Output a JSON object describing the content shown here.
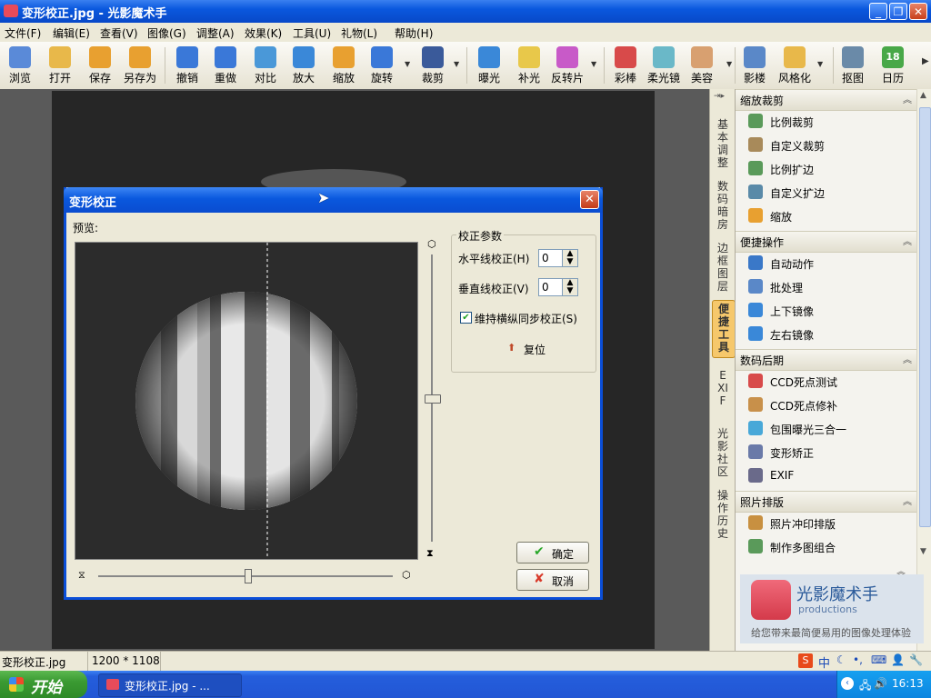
{
  "window": {
    "title": "变形校正.jpg - 光影魔术手",
    "buttons": [
      "_",
      "❐",
      "✕"
    ]
  },
  "menu": [
    "文件(F)",
    "编辑(E)",
    "查看(V)",
    "图像(G)",
    "调整(A)",
    "效果(K)",
    "工具(U)",
    "礼物(L)",
    "帮助(H)"
  ],
  "toolbar": [
    {
      "label": "浏览",
      "icon": "browse-icon",
      "color": "#5a8ad8"
    },
    {
      "label": "打开",
      "icon": "open-folder-icon",
      "color": "#e8b84a"
    },
    {
      "label": "保存",
      "icon": "save-icon",
      "color": "#e8a030"
    },
    {
      "label": "另存为",
      "icon": "save-as-icon",
      "color": "#e8a030"
    },
    {
      "label": "撤销",
      "icon": "undo-icon",
      "color": "#3a78d8"
    },
    {
      "label": "重做",
      "icon": "redo-icon",
      "color": "#3a78d8"
    },
    {
      "label": "对比",
      "icon": "compare-icon",
      "color": "#4a98d8"
    },
    {
      "label": "放大",
      "icon": "zoom-in-icon",
      "color": "#3a88d8"
    },
    {
      "label": "缩放",
      "icon": "resize-icon",
      "color": "#e8a030"
    },
    {
      "label": "旋转",
      "icon": "rotate-icon",
      "color": "#3a78d8"
    },
    {
      "label": "裁剪",
      "icon": "crop-icon",
      "color": "#3a5a9a"
    },
    {
      "label": "曝光",
      "icon": "exposure-icon",
      "color": "#3a88d8"
    },
    {
      "label": "补光",
      "icon": "fill-light-icon",
      "color": "#e8c84a"
    },
    {
      "label": "反转片",
      "icon": "reversal-film-icon",
      "color": "#c85ac8"
    },
    {
      "label": "彩棒",
      "icon": "color-wand-icon",
      "color": "#d84a4a"
    },
    {
      "label": "柔光镜",
      "icon": "soft-light-icon",
      "color": "#6ab8c8"
    },
    {
      "label": "美容",
      "icon": "beauty-icon",
      "color": "#d8a070"
    },
    {
      "label": "影楼",
      "icon": "studio-icon",
      "color": "#5a88c8"
    },
    {
      "label": "风格化",
      "icon": "stylize-icon",
      "color": "#e8b84a"
    },
    {
      "label": "抠图",
      "icon": "cutout-icon",
      "color": "#6a8aa8"
    },
    {
      "label": "日历",
      "icon": "calendar-icon",
      "color": "#48a848",
      "badge": "18"
    }
  ],
  "side_tabs": [
    "基本调整",
    "数码暗房",
    "边框图层",
    "便捷工具",
    "EXIF",
    "光影社区",
    "操作历史"
  ],
  "active_side_tab": "便捷工具",
  "panel": {
    "sections": [
      {
        "title": "缩放裁剪",
        "items": [
          {
            "label": "比例裁剪",
            "icon": "ratio-crop-icon",
            "color": "#5a9a5a"
          },
          {
            "label": "自定义裁剪",
            "icon": "custom-crop-icon",
            "color": "#a88a5a"
          },
          {
            "label": "比例扩边",
            "icon": "ratio-expand-icon",
            "color": "#5a9a5a"
          },
          {
            "label": "自定义扩边",
            "icon": "custom-expand-icon",
            "color": "#5a8aa8"
          },
          {
            "label": "缩放",
            "icon": "resize-icon",
            "color": "#e8a030"
          }
        ]
      },
      {
        "title": "便捷操作",
        "items": [
          {
            "label": "自动动作",
            "icon": "auto-action-icon",
            "color": "#3a78c8"
          },
          {
            "label": "批处理",
            "icon": "batch-icon",
            "color": "#5a88c8"
          },
          {
            "label": "上下镜像",
            "icon": "flip-vertical-icon",
            "color": "#3a88d8"
          },
          {
            "label": "左右镜像",
            "icon": "flip-horizontal-icon",
            "color": "#3a88d8"
          }
        ]
      },
      {
        "title": "数码后期",
        "items": [
          {
            "label": "CCD死点测试",
            "icon": "ccd-test-icon",
            "color": "#d84a4a"
          },
          {
            "label": "CCD死点修补",
            "icon": "ccd-repair-icon",
            "color": "#c8904a"
          },
          {
            "label": "包围曝光三合一",
            "icon": "bracket-exposure-icon",
            "color": "#48a8d8"
          },
          {
            "label": "变形矫正",
            "icon": "distortion-icon",
            "color": "#6a7aa8"
          },
          {
            "label": "EXIF",
            "icon": "exif-icon",
            "color": "#6a6a8a"
          }
        ]
      },
      {
        "title": "照片排版",
        "items": [
          {
            "label": "照片冲印排版",
            "icon": "print-layout-icon",
            "color": "#c89040"
          },
          {
            "label": "制作多图组合",
            "icon": "multi-image-icon",
            "color": "#5a9a5a"
          }
        ]
      }
    ],
    "logo": {
      "name": "光影魔术手",
      "sub": "productions",
      "tagline": "给您带来最简便易用的图像处理体验"
    }
  },
  "status": {
    "file": "变形校正.jpg",
    "size": "1200 * 1108"
  },
  "ime": [
    "S",
    "中",
    "☾",
    "•,",
    "⌨",
    "👤",
    "🔧"
  ],
  "taskbar": {
    "start": "开始",
    "task": "变形校正.jpg - ...",
    "clock": "16:13"
  },
  "dialog": {
    "title": "变形校正",
    "preview_label": "预览:",
    "group_title": "校正参数",
    "horizontal_label": "水平线校正(H)",
    "horizontal_value": "0",
    "vertical_label": "垂直线校正(V)",
    "vertical_value": "0",
    "sync_label": "维持横纵同步校正(S)",
    "sync_checked": true,
    "reset_label": "复位",
    "ok_label": "确定",
    "cancel_label": "取消"
  }
}
